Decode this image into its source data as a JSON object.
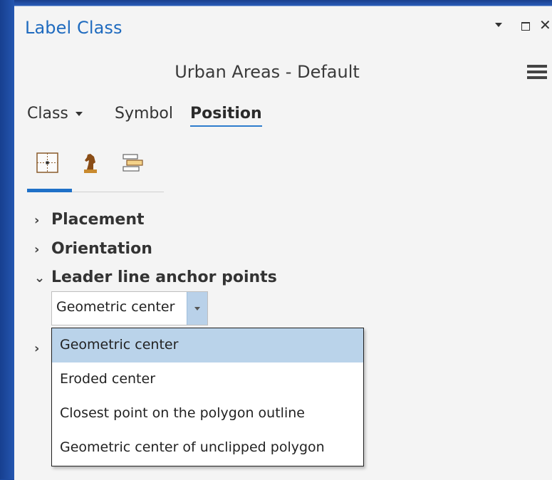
{
  "window": {
    "title": "Label Class",
    "subtitle": "Urban Areas - Default",
    "controls": [
      "pin-icon",
      "maximize-icon",
      "close-icon"
    ],
    "menu_icon": "hamburger-menu-icon"
  },
  "tabs": [
    {
      "label": "Class",
      "has_dropdown": true
    },
    {
      "label": "Symbol"
    },
    {
      "label": "Position",
      "active": true
    }
  ],
  "subtabs": [
    {
      "icon": "placement-grid-icon",
      "active": true
    },
    {
      "icon": "chess-knight-icon"
    },
    {
      "icon": "stacked-labels-icon"
    }
  ],
  "sections": [
    {
      "label": "Placement",
      "expanded": false
    },
    {
      "label": "Orientation",
      "expanded": false
    },
    {
      "label": "Leader line anchor points",
      "expanded": true
    }
  ],
  "anchor_select": {
    "value": "Geometric center",
    "options": [
      "Geometric center",
      "Eroded center",
      "Closest point on the polygon outline",
      "Geometric center of unclipped polygon"
    ],
    "selected_index": 0
  },
  "colors": {
    "title": "#1f6bbf",
    "accent": "#1f71c8",
    "selection": "#bad3ea",
    "desktop": "#1d4aa0"
  }
}
